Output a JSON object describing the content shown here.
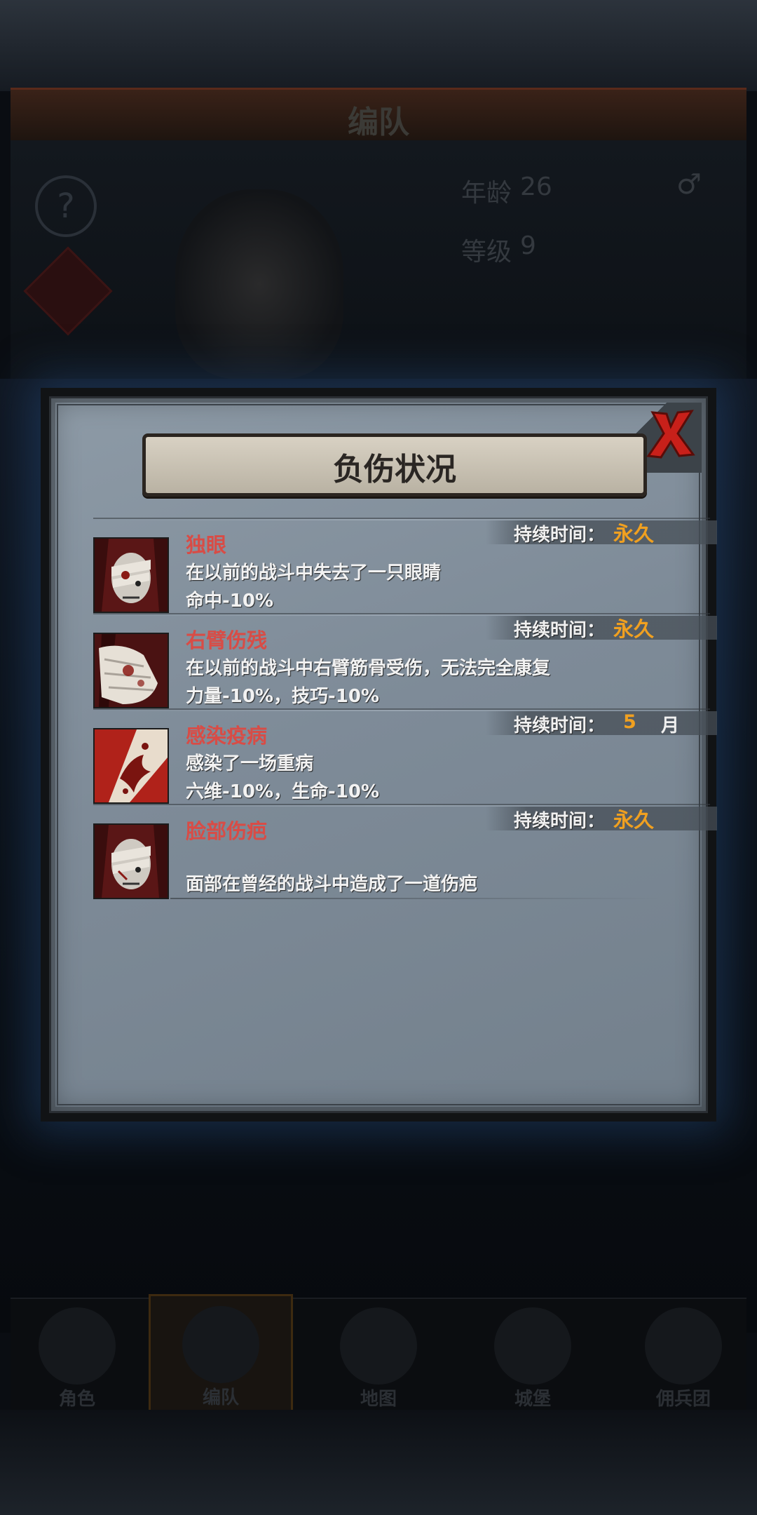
{
  "background": {
    "header_title": "编队",
    "stats": {
      "age_label": "年龄",
      "age_value": "26",
      "level_label": "等级",
      "level_value": "9"
    },
    "tabs": [
      {
        "label": "角色"
      },
      {
        "label": "编队"
      },
      {
        "label": "地图"
      },
      {
        "label": "城堡"
      },
      {
        "label": "佣兵团"
      }
    ]
  },
  "modal": {
    "title": "负伤状况",
    "close_icon": "close-x-icon",
    "duration_label": "持续时间：",
    "injuries": [
      {
        "icon": "bandaged-head-icon",
        "name": "独眼",
        "description": "在以前的战斗中失去了一只眼睛",
        "effect": "命中-10%",
        "duration": "永久"
      },
      {
        "icon": "bandaged-arm-icon",
        "name": "右臂伤残",
        "description": "在以前的战斗中右臂筋骨受伤，无法完全康复",
        "effect": "力量-10%，技巧-10%",
        "duration": "永久"
      },
      {
        "icon": "disease-icon",
        "name": "感染疫病",
        "description": "感染了一场重病",
        "effect": "六维-10%，生命-10%",
        "duration_number": "5",
        "duration_unit": "月"
      },
      {
        "icon": "scarred-face-icon",
        "name": "脸部伤疤",
        "description": "面部在曾经的战斗中造成了一道伤疤",
        "duration": "永久"
      }
    ]
  },
  "colors": {
    "injury_name": "#d84c46",
    "duration_value": "#f0a020",
    "panel": "#8d9aa6"
  }
}
